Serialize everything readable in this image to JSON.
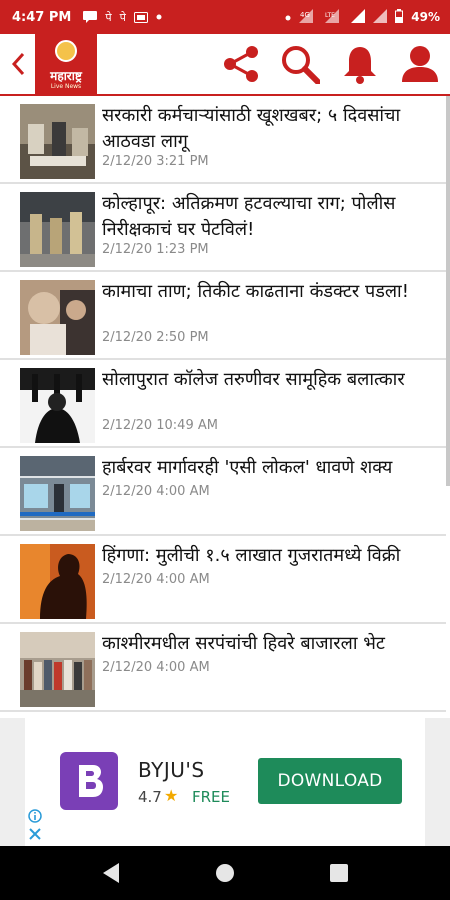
{
  "status_bar": {
    "time": "4:47 PM",
    "app_icons": [
      "पे",
      "पे"
    ],
    "battery": "49%"
  },
  "app_bar": {
    "logo_text": "महाराष्ट्र",
    "logo_subtext": "Live News",
    "icons": [
      "back-arrow-icon",
      "share-icon",
      "search-icon",
      "bell-icon",
      "profile-icon"
    ],
    "accent_color": "#c8201f"
  },
  "news": [
    {
      "headline": "सरकारी कर्मचाऱ्यांसाठी खूशखबर; ५ दिवसांचा आठवडा लागू",
      "time": "2/12/20 3:21 PM"
    },
    {
      "headline": "कोल्हापूर: अतिक्रमण हटवल्याचा राग; पोलीस निरीक्षकाचं घर पेटविलं!",
      "time": "2/12/20 1:23 PM"
    },
    {
      "headline": "कामाचा ताण; तिकीट काढताना कंडक्टर पडला!",
      "time": "2/12/20 2:50 PM"
    },
    {
      "headline": "सोलापुरात कॉलेज तरुणीवर सामूहिक बलात्कार",
      "time": "2/12/20 10:49 AM"
    },
    {
      "headline": "हार्बरवर मार्गावरही 'एसी लोकल' धावणे शक्य",
      "time": "2/12/20 4:00 AM"
    },
    {
      "headline": "हिंगणा: मुलीची १.५ लाखात गुजरातमध्ये विक्री",
      "time": "2/12/20 4:00 AM"
    },
    {
      "headline": "काश्मीरमधील सरपंचांची हिवरे बाजारला भेट",
      "time": "2/12/20 4:00 AM"
    }
  ],
  "ad": {
    "title": "BYJU'S",
    "rating": "4.7",
    "price": "FREE",
    "cta": "DOWNLOAD",
    "brand_color": "#7a3fb6",
    "cta_color": "#1e8b5a"
  }
}
